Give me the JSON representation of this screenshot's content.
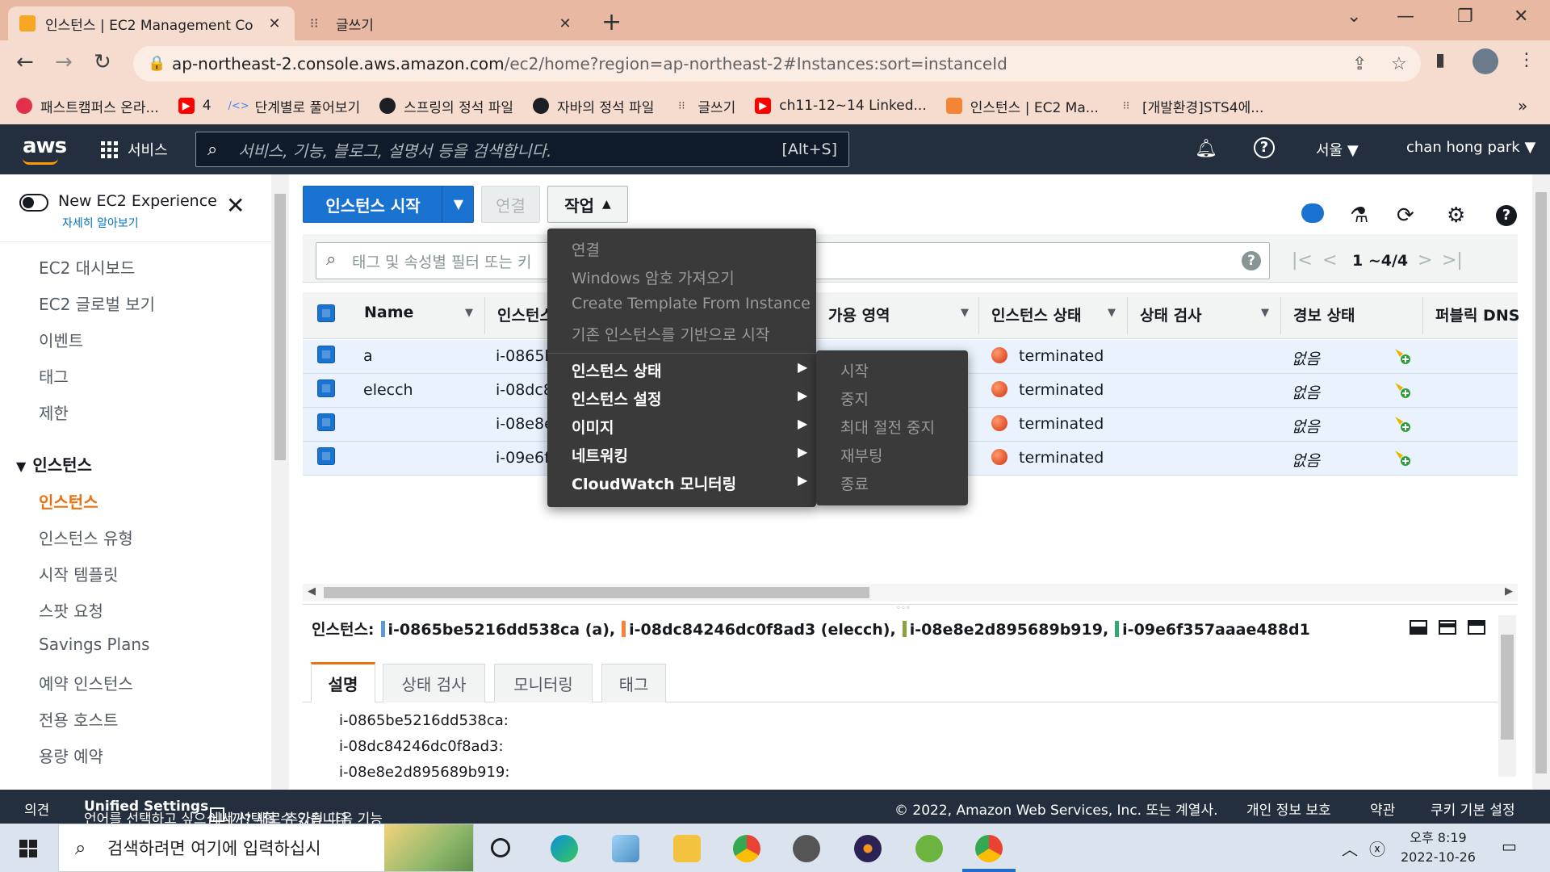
{
  "browser": {
    "tabs": [
      {
        "title": "인스턴스 | EC2 Management Co",
        "active": true,
        "icon": "aws-cube-icon"
      },
      {
        "title": "글쓰기",
        "active": false,
        "icon": "velog-icon"
      }
    ],
    "url_host": "ap-northeast-2.console.aws.amazon.com",
    "url_path": "/ec2/home?region=ap-northeast-2#Instances:sort=instanceId",
    "bookmarks": [
      {
        "label": "패스트캠퍼스 온라...",
        "icon": "fastcampus-icon",
        "color": "#e2304b"
      },
      {
        "label": "4",
        "icon": "youtube-icon",
        "color": "#ff0000"
      },
      {
        "label": "단계별로 풀어보기",
        "icon": "code-icon",
        "color": "#4285f4"
      },
      {
        "label": "스프링의 정석 파일",
        "icon": "github-icon",
        "color": "#1b1f23"
      },
      {
        "label": "자바의 정석 파일",
        "icon": "github-icon",
        "color": "#1b1f23"
      },
      {
        "label": "글쓰기",
        "icon": "velog-icon",
        "color": "#333333"
      },
      {
        "label": "ch11-12~14 Linked...",
        "icon": "youtube-icon",
        "color": "#ff0000"
      },
      {
        "label": "인스턴스 | EC2 Ma...",
        "icon": "aws-cube-icon",
        "color": "#f58536"
      },
      {
        "label": "[개발환경]STS4에...",
        "icon": "velog-icon",
        "color": "#333333"
      }
    ],
    "more_bookmarks": "»"
  },
  "aws": {
    "logo": "aws",
    "services": "서비스",
    "search_placeholder": "서비스, 기능, 블로그, 설명서 등을 검색합니다.",
    "search_shortcut": "[Alt+S]",
    "region": "서울 ▼",
    "user": "chan hong park ▼"
  },
  "sidebar": {
    "new_experience": "New EC2 Experience",
    "learn_more": "자세히 알아보기",
    "items": [
      "EC2 대시보드",
      "EC2 글로벌 보기",
      "이벤트",
      "태그",
      "제한"
    ],
    "section": "인스턴스",
    "section_items": [
      "인스턴스",
      "인스턴스 유형",
      "시작 템플릿",
      "스팟 요청",
      "Savings Plans",
      "예약 인스턴스",
      "전용 호스트",
      "용량 예약"
    ],
    "active_item": "인스턴스"
  },
  "toolbar": {
    "launch": "인스턴스 시작",
    "connect": "연결",
    "actions": "작업"
  },
  "filter_placeholder": "태그 및 속성별 필터 또는 키",
  "pagination": "1 ~4/4",
  "columns": [
    "Name",
    "인스턴스",
    "가용 영역",
    "인스턴스 상태",
    "상태 검사",
    "경보 상태",
    "퍼블릭 DNS"
  ],
  "rows": [
    {
      "name": "a",
      "id": "i-0865b",
      "state": "terminated",
      "alarm": "없음"
    },
    {
      "name": "elecch",
      "id": "i-08dc8",
      "state": "terminated",
      "alarm": "없음"
    },
    {
      "name": "",
      "id": "i-08e8e",
      "state": "terminated",
      "alarm": "없음"
    },
    {
      "name": "",
      "id": "i-09e6f",
      "state": "terminated",
      "alarm": "없음"
    }
  ],
  "actions_menu": {
    "disabled": [
      "연결",
      "Windows 암호 가져오기",
      "Create Template From Instance",
      "기존 인스턴스를 기반으로 시작"
    ],
    "submenus": [
      "인스턴스 상태",
      "인스턴스 설정",
      "이미지",
      "네트워킹",
      "CloudWatch 모니터링"
    ]
  },
  "state_submenu": [
    "시작",
    "중지",
    "최대 절전 중지",
    "재부팅",
    "종료"
  ],
  "selection": {
    "label": "인스턴스:",
    "items": [
      {
        "text": "i-0865be5216dd538ca (a),",
        "color": "#5b9bd5"
      },
      {
        "text": "i-08dc84246dc0f8ad3 (elecch),",
        "color": "#f58536"
      },
      {
        "text": "i-08e8e2d895689b919,",
        "color": "#8aa33a"
      },
      {
        "text": "i-09e6f357aaae488d1",
        "color": "#2eaa72"
      }
    ]
  },
  "detail_tabs": [
    "설명",
    "상태 검사",
    "모니터링",
    "태그"
  ],
  "detail_lines": [
    "i-0865be5216dd538ca:",
    "i-08dc84246dc0f8ad3:",
    "i-08e8e2d895689b919:"
  ],
  "footer": {
    "feedback": "의견",
    "lang_pre": "언어를 선택하고 싶으십니까? 새로 추가된 다음 기능",
    "lang_link": "Unified Settings",
    "lang_post": "에서 선택할 수 있습니다.",
    "copyright": "© 2022, Amazon Web Services, Inc. 또는 계열사.",
    "privacy": "개인 정보 보호",
    "terms": "약관",
    "cookies": "쿠키 기본 설정"
  },
  "taskbar": {
    "search_placeholder": "검색하려면 여기에 입력하십시",
    "time": "오후 8:19",
    "date": "2022-10-26"
  }
}
